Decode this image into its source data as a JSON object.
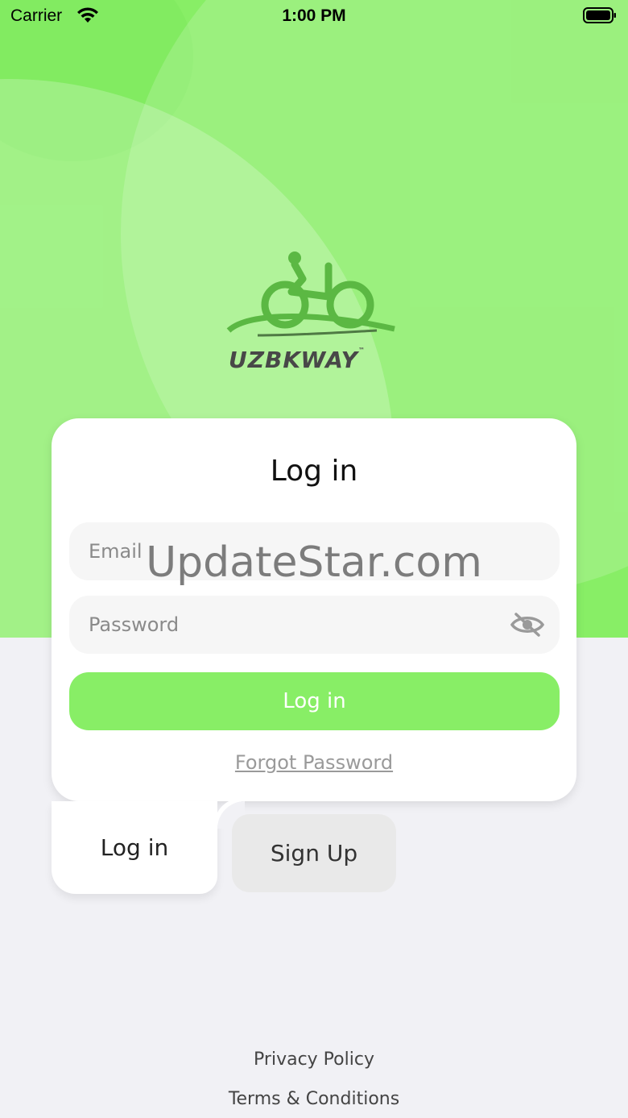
{
  "status_bar": {
    "carrier": "Carrier",
    "time": "1:00 PM"
  },
  "logo": {
    "text": "UZBKWAY",
    "trademark": "™"
  },
  "card": {
    "title": "Log in",
    "email": {
      "placeholder": "Email",
      "value": ""
    },
    "password": {
      "placeholder": "Password",
      "value": ""
    },
    "login_button": "Log in",
    "forgot_link": "Forgot Password"
  },
  "tabs": {
    "login": "Log in",
    "signup": "Sign Up"
  },
  "footer": {
    "privacy": "Privacy Policy",
    "terms": "Terms & Conditions"
  },
  "watermark": "UpdateStar.com",
  "colors": {
    "accent": "#88ee66",
    "logo_green": "#5bb843",
    "background": "#f1f1f5"
  },
  "icons": {
    "wifi": "wifi-icon",
    "battery": "battery-icon",
    "password_toggle": "eye-slash-icon"
  }
}
